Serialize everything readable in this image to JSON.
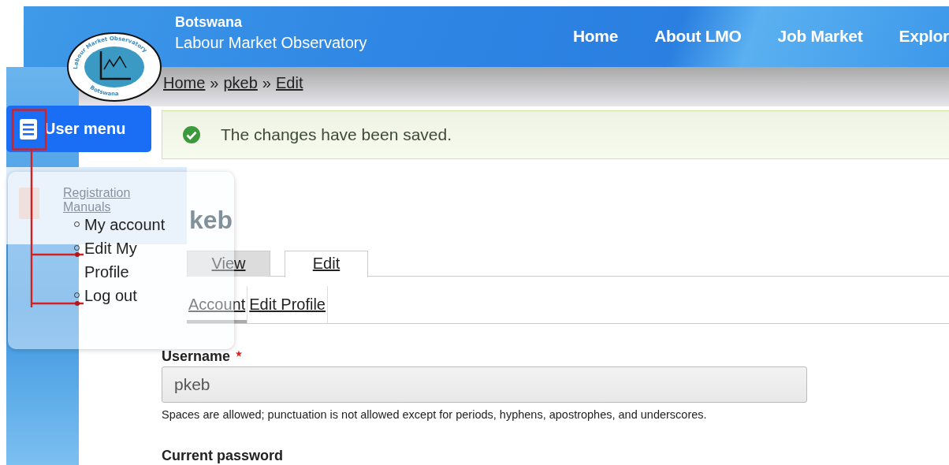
{
  "header": {
    "site_name": "Botswana",
    "site_subtitle": "Labour Market Observatory",
    "logo": {
      "ring_text": "Labour Market Observatory",
      "bottom_text": "Botswana"
    },
    "nav": [
      {
        "label": "Home"
      },
      {
        "label": "About LMO"
      },
      {
        "label": "Job Market"
      },
      {
        "label": "Explor"
      }
    ]
  },
  "breadcrumb": [
    {
      "label": "Home"
    },
    {
      "label": "pkeb"
    },
    {
      "label": "Edit"
    }
  ],
  "breadcrumb_separator": "»",
  "sidebar": {
    "user_menu": {
      "label": "User menu",
      "expanded": true,
      "items": [
        {
          "label": "My account"
        },
        {
          "label": "Edit My Profile"
        },
        {
          "label": "Log out"
        }
      ]
    },
    "background_item": {
      "label": "Registration Manuals"
    }
  },
  "message": {
    "kind": "status",
    "text": "The changes have been saved."
  },
  "page_title": "keb",
  "tabs": [
    {
      "label": "View",
      "selected": false
    },
    {
      "label": "Edit",
      "selected": true
    }
  ],
  "subtabs": [
    {
      "label": "Account",
      "selected": true
    },
    {
      "label": "Edit Profile",
      "selected": false
    }
  ],
  "form": {
    "fields": [
      {
        "kind": "text",
        "label": "Username",
        "required": true,
        "value": "pkeb",
        "description": "Spaces are allowed; punctuation is not allowed except for periods, hyphens, apostrophes, and underscores."
      },
      {
        "kind": "heading",
        "label": "Current password",
        "required": false
      }
    ]
  }
}
